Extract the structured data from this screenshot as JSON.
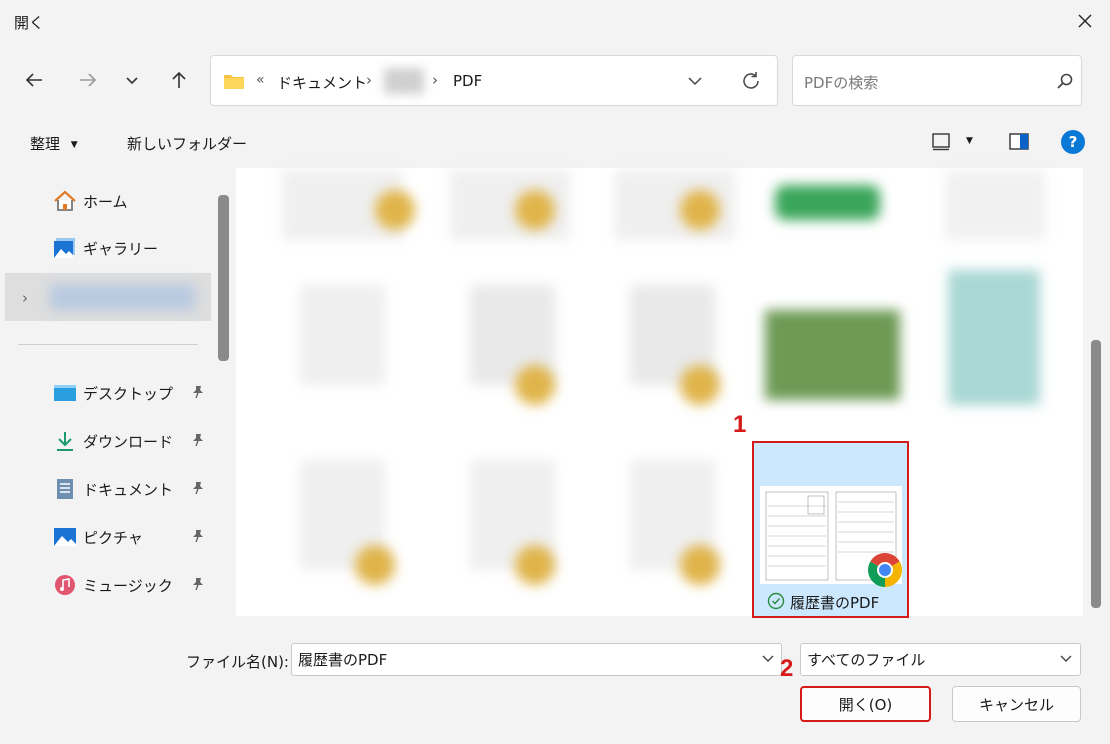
{
  "window": {
    "title": "開く"
  },
  "address": {
    "crumbs": [
      "ドキュメント",
      "PDF"
    ],
    "overflow": "«"
  },
  "search": {
    "placeholder": "PDFの検索"
  },
  "toolbar": {
    "organize": "整理",
    "new_folder": "新しいフォルダー"
  },
  "sidebar": {
    "items": [
      {
        "label": "ホーム",
        "icon": "home-icon"
      },
      {
        "label": "ギャラリー",
        "icon": "gallery-icon"
      },
      {
        "label": "デスクトップ",
        "icon": "desktop-icon",
        "pinned": true
      },
      {
        "label": "ダウンロード",
        "icon": "download-icon",
        "pinned": true
      },
      {
        "label": "ドキュメント",
        "icon": "document-icon",
        "pinned": true
      },
      {
        "label": "ピクチャ",
        "icon": "pictures-icon",
        "pinned": true
      },
      {
        "label": "ミュージック",
        "icon": "music-icon",
        "pinned": true
      }
    ]
  },
  "files": {
    "selected": {
      "name": "履歴書のPDF"
    }
  },
  "annotations": {
    "step1": "1",
    "step2": "2"
  },
  "footer": {
    "filename_label": "ファイル名(N):",
    "filename_value": "履歴書のPDF",
    "filetype": "すべてのファイル",
    "open_button": "開く(O)",
    "cancel_button": "キャンセル"
  },
  "colors": {
    "accent": "#0067c0",
    "selection": "#cce8ff",
    "highlight_red": "#d61a1a"
  }
}
